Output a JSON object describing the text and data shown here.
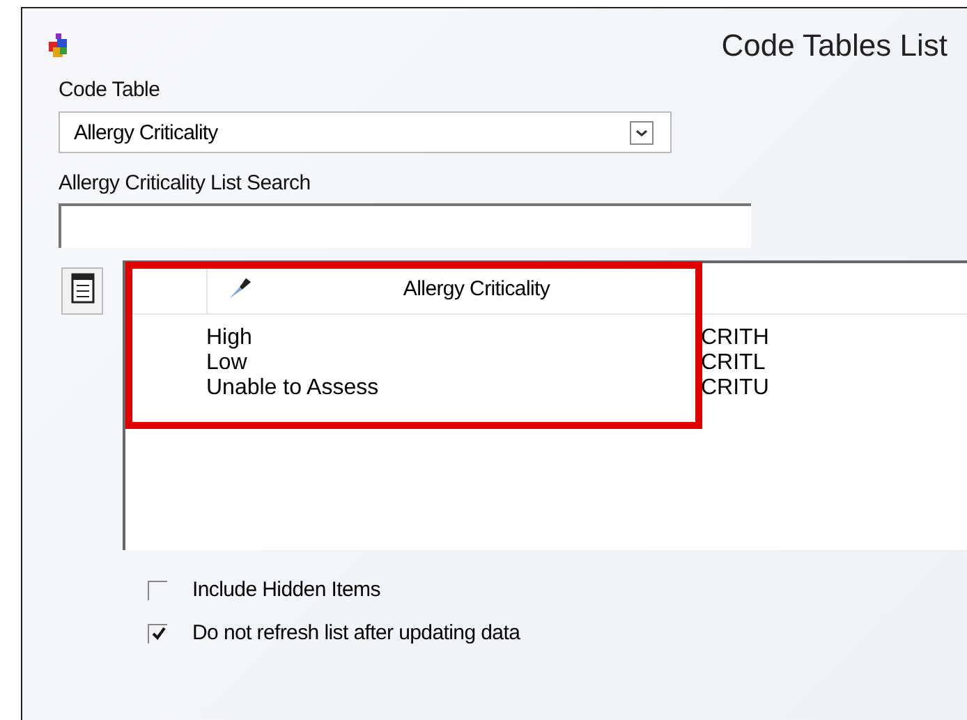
{
  "window": {
    "title": "Code Tables List"
  },
  "code_table": {
    "label": "Code Table",
    "value": "Allergy Criticality"
  },
  "search": {
    "label": "Allergy Criticality List Search"
  },
  "list": {
    "columns": [
      "Allergy Criticality"
    ],
    "rows": [
      {
        "name": "High",
        "code": "CRITH"
      },
      {
        "name": "Low",
        "code": "CRITL"
      },
      {
        "name": "Unable to Assess",
        "code": "CRITU"
      }
    ]
  },
  "options": [
    {
      "label": "Include Hidden Items",
      "checked": false
    },
    {
      "label": "Do not refresh list after updating data",
      "checked": true
    }
  ]
}
